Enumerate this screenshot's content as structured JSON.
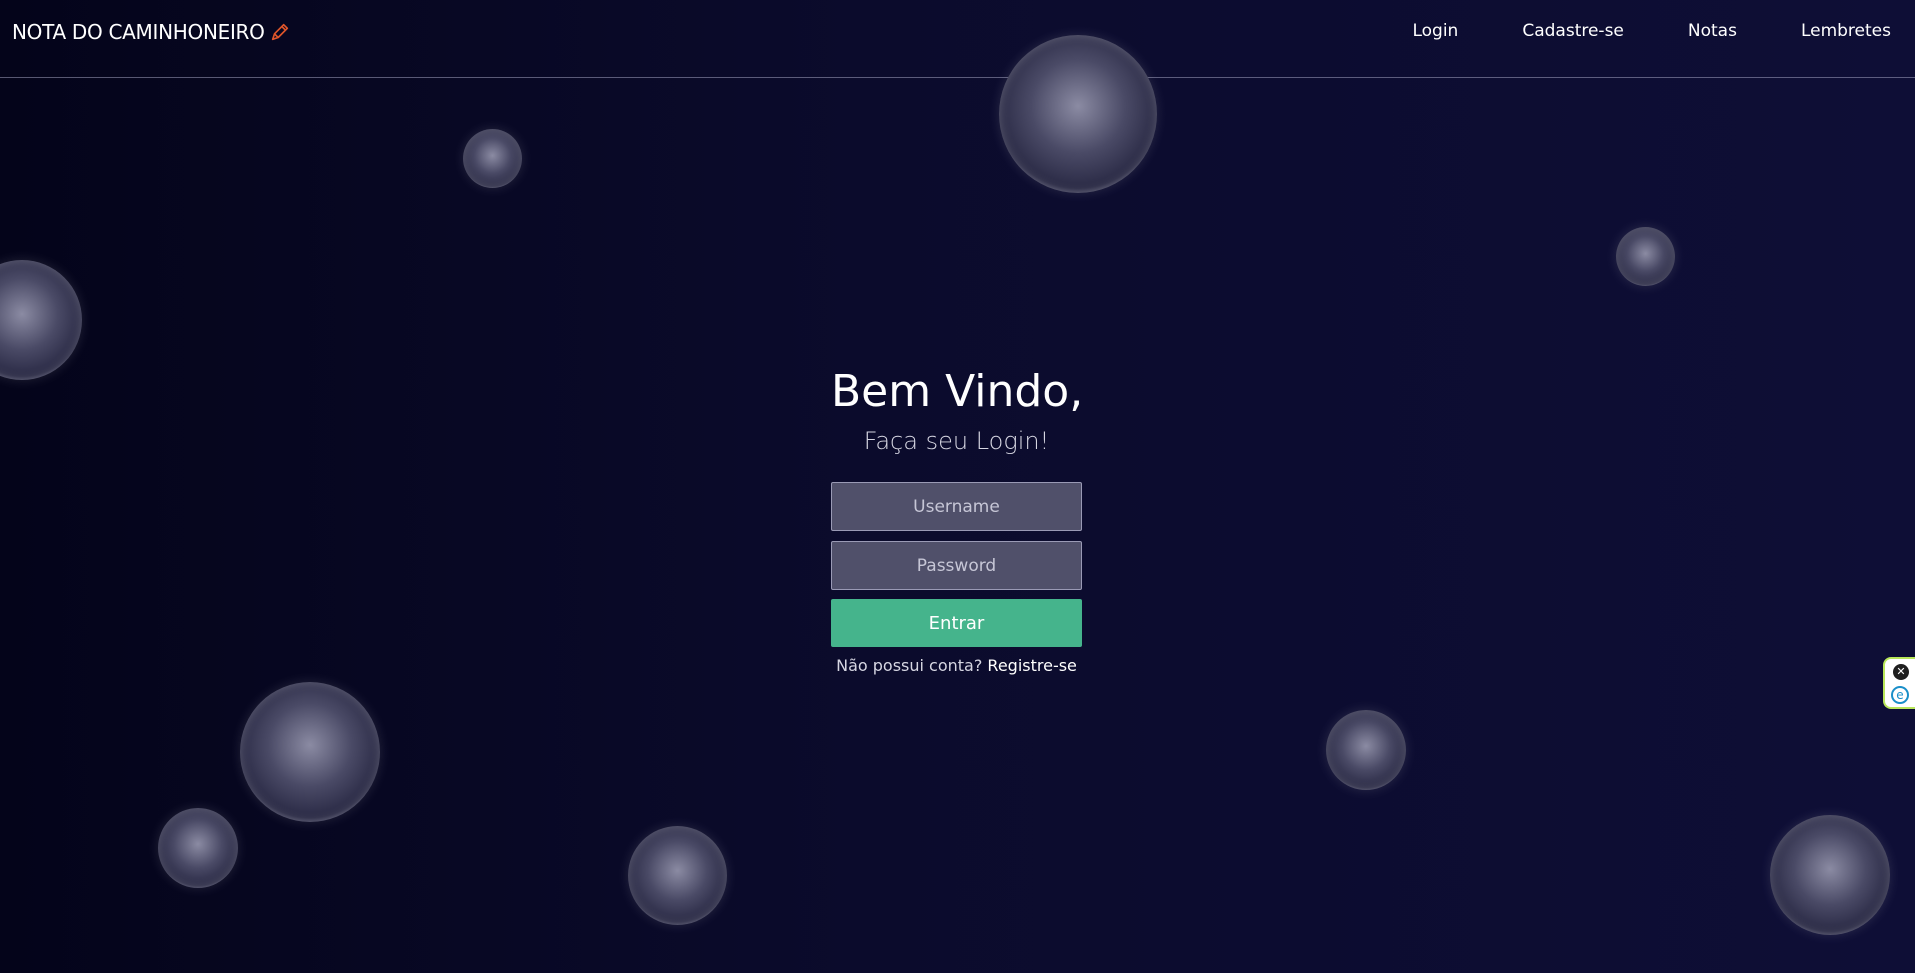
{
  "brand": {
    "name": "NOTA DO CAMINHONEIRO",
    "icon": "pencil-icon",
    "icon_color": "#e0552a"
  },
  "nav": {
    "items": [
      {
        "label": "Login"
      },
      {
        "label": "Cadastre-se"
      },
      {
        "label": "Notas"
      },
      {
        "label": "Lembretes"
      }
    ]
  },
  "login": {
    "title": "Bem Vindo,",
    "subtitle": "Faça seu Login!",
    "username_placeholder": "Username",
    "password_placeholder": "Password",
    "submit_label": "Entrar",
    "register_prompt": "Não possui conta?",
    "register_link": "Registre-se"
  },
  "colors": {
    "background": "#0b0b2c",
    "accent_button": "#45b48c",
    "input_background": "#50506a"
  },
  "side_widget": {
    "close_icon": "close-icon",
    "extension_icon": "extension-e-icon"
  }
}
